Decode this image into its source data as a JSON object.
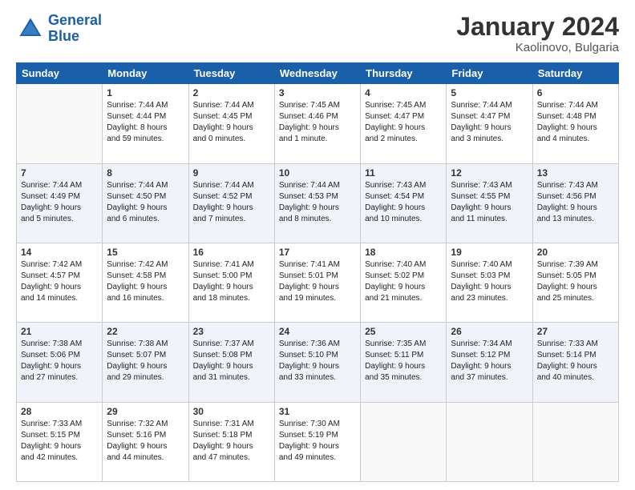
{
  "header": {
    "logo_line1": "General",
    "logo_line2": "Blue",
    "title": "January 2024",
    "subtitle": "Kaolinovo, Bulgaria"
  },
  "days_of_week": [
    "Sunday",
    "Monday",
    "Tuesday",
    "Wednesday",
    "Thursday",
    "Friday",
    "Saturday"
  ],
  "weeks": [
    [
      {
        "day": "",
        "info": ""
      },
      {
        "day": "1",
        "info": "Sunrise: 7:44 AM\nSunset: 4:44 PM\nDaylight: 8 hours\nand 59 minutes."
      },
      {
        "day": "2",
        "info": "Sunrise: 7:44 AM\nSunset: 4:45 PM\nDaylight: 9 hours\nand 0 minutes."
      },
      {
        "day": "3",
        "info": "Sunrise: 7:45 AM\nSunset: 4:46 PM\nDaylight: 9 hours\nand 1 minute."
      },
      {
        "day": "4",
        "info": "Sunrise: 7:45 AM\nSunset: 4:47 PM\nDaylight: 9 hours\nand 2 minutes."
      },
      {
        "day": "5",
        "info": "Sunrise: 7:44 AM\nSunset: 4:47 PM\nDaylight: 9 hours\nand 3 minutes."
      },
      {
        "day": "6",
        "info": "Sunrise: 7:44 AM\nSunset: 4:48 PM\nDaylight: 9 hours\nand 4 minutes."
      }
    ],
    [
      {
        "day": "7",
        "info": "Sunrise: 7:44 AM\nSunset: 4:49 PM\nDaylight: 9 hours\nand 5 minutes."
      },
      {
        "day": "8",
        "info": "Sunrise: 7:44 AM\nSunset: 4:50 PM\nDaylight: 9 hours\nand 6 minutes."
      },
      {
        "day": "9",
        "info": "Sunrise: 7:44 AM\nSunset: 4:52 PM\nDaylight: 9 hours\nand 7 minutes."
      },
      {
        "day": "10",
        "info": "Sunrise: 7:44 AM\nSunset: 4:53 PM\nDaylight: 9 hours\nand 8 minutes."
      },
      {
        "day": "11",
        "info": "Sunrise: 7:43 AM\nSunset: 4:54 PM\nDaylight: 9 hours\nand 10 minutes."
      },
      {
        "day": "12",
        "info": "Sunrise: 7:43 AM\nSunset: 4:55 PM\nDaylight: 9 hours\nand 11 minutes."
      },
      {
        "day": "13",
        "info": "Sunrise: 7:43 AM\nSunset: 4:56 PM\nDaylight: 9 hours\nand 13 minutes."
      }
    ],
    [
      {
        "day": "14",
        "info": "Sunrise: 7:42 AM\nSunset: 4:57 PM\nDaylight: 9 hours\nand 14 minutes."
      },
      {
        "day": "15",
        "info": "Sunrise: 7:42 AM\nSunset: 4:58 PM\nDaylight: 9 hours\nand 16 minutes."
      },
      {
        "day": "16",
        "info": "Sunrise: 7:41 AM\nSunset: 5:00 PM\nDaylight: 9 hours\nand 18 minutes."
      },
      {
        "day": "17",
        "info": "Sunrise: 7:41 AM\nSunset: 5:01 PM\nDaylight: 9 hours\nand 19 minutes."
      },
      {
        "day": "18",
        "info": "Sunrise: 7:40 AM\nSunset: 5:02 PM\nDaylight: 9 hours\nand 21 minutes."
      },
      {
        "day": "19",
        "info": "Sunrise: 7:40 AM\nSunset: 5:03 PM\nDaylight: 9 hours\nand 23 minutes."
      },
      {
        "day": "20",
        "info": "Sunrise: 7:39 AM\nSunset: 5:05 PM\nDaylight: 9 hours\nand 25 minutes."
      }
    ],
    [
      {
        "day": "21",
        "info": "Sunrise: 7:38 AM\nSunset: 5:06 PM\nDaylight: 9 hours\nand 27 minutes."
      },
      {
        "day": "22",
        "info": "Sunrise: 7:38 AM\nSunset: 5:07 PM\nDaylight: 9 hours\nand 29 minutes."
      },
      {
        "day": "23",
        "info": "Sunrise: 7:37 AM\nSunset: 5:08 PM\nDaylight: 9 hours\nand 31 minutes."
      },
      {
        "day": "24",
        "info": "Sunrise: 7:36 AM\nSunset: 5:10 PM\nDaylight: 9 hours\nand 33 minutes."
      },
      {
        "day": "25",
        "info": "Sunrise: 7:35 AM\nSunset: 5:11 PM\nDaylight: 9 hours\nand 35 minutes."
      },
      {
        "day": "26",
        "info": "Sunrise: 7:34 AM\nSunset: 5:12 PM\nDaylight: 9 hours\nand 37 minutes."
      },
      {
        "day": "27",
        "info": "Sunrise: 7:33 AM\nSunset: 5:14 PM\nDaylight: 9 hours\nand 40 minutes."
      }
    ],
    [
      {
        "day": "28",
        "info": "Sunrise: 7:33 AM\nSunset: 5:15 PM\nDaylight: 9 hours\nand 42 minutes."
      },
      {
        "day": "29",
        "info": "Sunrise: 7:32 AM\nSunset: 5:16 PM\nDaylight: 9 hours\nand 44 minutes."
      },
      {
        "day": "30",
        "info": "Sunrise: 7:31 AM\nSunset: 5:18 PM\nDaylight: 9 hours\nand 47 minutes."
      },
      {
        "day": "31",
        "info": "Sunrise: 7:30 AM\nSunset: 5:19 PM\nDaylight: 9 hours\nand 49 minutes."
      },
      {
        "day": "",
        "info": ""
      },
      {
        "day": "",
        "info": ""
      },
      {
        "day": "",
        "info": ""
      }
    ]
  ]
}
